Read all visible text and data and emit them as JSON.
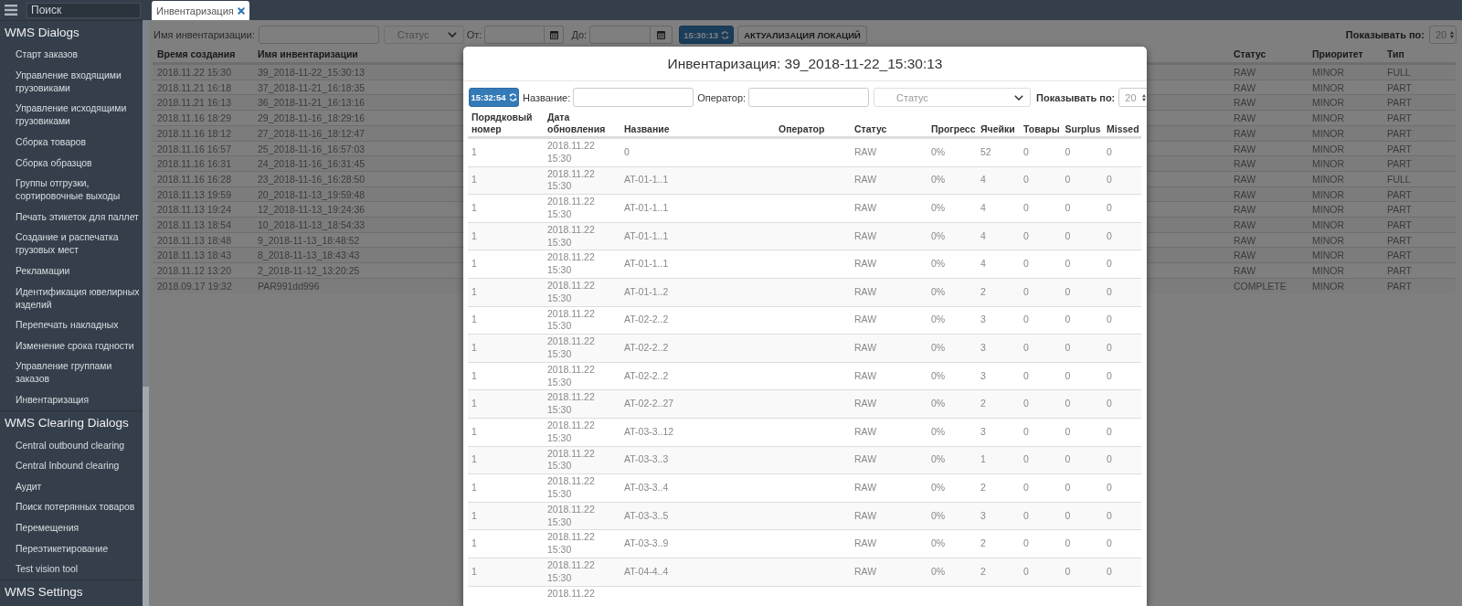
{
  "sidebar": {
    "search": {
      "placeholder": "Поиск"
    },
    "sections": [
      {
        "title": "WMS Dialogs",
        "items": [
          "Старт заказов",
          "Управление входящими грузовиками",
          "Управление исходящими грузовиками",
          "Сборка товаров",
          "Сборка образцов",
          "Группы отгрузки, сортировочные выходы",
          "Печать этикеток для паллет",
          "Создание и распечатка грузовых мест",
          "Рекламации",
          "Идентификация ювелирных изделий",
          "Перепечать накладных",
          "Изменение срока годности",
          "Управление группами заказов",
          "Инвентаризация"
        ]
      },
      {
        "title": "WMS Clearing Dialogs",
        "items": [
          "Central outbound clearing",
          "Central Inbound clearing",
          "Аудит",
          "Поиск потерянных товаров",
          "Перемещения",
          "Переэтикетирование",
          "Test vision tool"
        ]
      },
      {
        "title": "WMS Settings"
      }
    ]
  },
  "tabs": [
    {
      "label": "Инвентаризация",
      "selected": true
    }
  ],
  "toolbar": {
    "name_label": "Имя инвентаризации:",
    "status_placeholder": "Статус",
    "from_label": "От:",
    "to_label": "До:",
    "refresh_time": "15:30:13",
    "locations_button": "АКТУАЛИЗАЦИЯ ЛОКАЦИЙ",
    "page_size_label": "Показывать по:",
    "page_size": "20"
  },
  "table": {
    "columns": [
      "Время создания",
      "Имя инвентаризации",
      "Статус",
      "Приоритет",
      "Тип"
    ],
    "rows": [
      [
        "2018.11.22 15:30",
        "39_2018-11-22_15:30:13",
        "RAW",
        "MINOR",
        "FULL"
      ],
      [
        "2018.11.21 16:18",
        "37_2018-11-21_16:18:35",
        "RAW",
        "MINOR",
        "PART"
      ],
      [
        "2018.11.21 16:13",
        "36_2018-11-21_16:13:16",
        "RAW",
        "MINOR",
        "PART"
      ],
      [
        "2018.11.16 18:29",
        "29_2018-11-16_18:29:16",
        "RAW",
        "MINOR",
        "PART"
      ],
      [
        "2018.11.16 18:12",
        "27_2018-11-16_18:12:47",
        "RAW",
        "MINOR",
        "PART"
      ],
      [
        "2018.11.16 16:57",
        "25_2018-11-16_16:57:03",
        "RAW",
        "MINOR",
        "PART"
      ],
      [
        "2018.11.16 16:31",
        "24_2018-11-16_16:31:45",
        "RAW",
        "MINOR",
        "PART"
      ],
      [
        "2018.11.16 16:28",
        "23_2018-11-16_16:28:50",
        "RAW",
        "MINOR",
        "FULL"
      ],
      [
        "2018.11.13 19:59",
        "20_2018-11-13_19:59:48",
        "RAW",
        "MINOR",
        "PART"
      ],
      [
        "2018.11.13 19:24",
        "12_2018-11-13_19:24:36",
        "RAW",
        "MINOR",
        "PART"
      ],
      [
        "2018.11.13 18:54",
        "10_2018-11-13_18:54:33",
        "RAW",
        "MINOR",
        "PART"
      ],
      [
        "2018.11.13 18:48",
        "9_2018-11-13_18:48:52",
        "RAW",
        "MINOR",
        "PART"
      ],
      [
        "2018.11.13 18:43",
        "8_2018-11-13_18:43:43",
        "RAW",
        "MINOR",
        "PART"
      ],
      [
        "2018.11.12 13:20",
        "2_2018-11-12_13:20:25",
        "RAW",
        "MINOR",
        "PART"
      ],
      [
        "2018.09.17 19:32",
        "PAR991dd996",
        "COMPLETE",
        "MINOR",
        "PART"
      ]
    ]
  },
  "dialog": {
    "title": "Инвентаризация: 39_2018-11-22_15:30:13",
    "refresh_time": "15:32:54",
    "name_label": "Название:",
    "operator_label": "Оператор:",
    "status_placeholder": "Статус",
    "page_size_label": "Показывать по:",
    "page_size": "20",
    "columns": [
      "Порядковый номер",
      "Дата обновления",
      "Название",
      "Оператор",
      "Статус",
      "Прогресс",
      "Ячейки",
      "Товары",
      "Surplus",
      "Missed"
    ],
    "rows": [
      {
        "number": "1",
        "updated": "2018.11.22 15:30",
        "name": "0",
        "status": "RAW",
        "progress": "0%",
        "cells": "52",
        "goods": "0",
        "surplus": "0",
        "missed": "0"
      },
      {
        "number": "1",
        "updated": "2018.11.22 15:30",
        "name": "AT-01-1..1",
        "status": "RAW",
        "progress": "0%",
        "cells": "4",
        "goods": "0",
        "surplus": "0",
        "missed": "0"
      },
      {
        "number": "1",
        "updated": "2018.11.22 15:30",
        "name": "AT-01-1..1",
        "status": "RAW",
        "progress": "0%",
        "cells": "4",
        "goods": "0",
        "surplus": "0",
        "missed": "0"
      },
      {
        "number": "1",
        "updated": "2018.11.22 15:30",
        "name": "AT-01-1..1",
        "status": "RAW",
        "progress": "0%",
        "cells": "4",
        "goods": "0",
        "surplus": "0",
        "missed": "0"
      },
      {
        "number": "1",
        "updated": "2018.11.22 15:30",
        "name": "AT-01-1..1",
        "status": "RAW",
        "progress": "0%",
        "cells": "4",
        "goods": "0",
        "surplus": "0",
        "missed": "0"
      },
      {
        "number": "1",
        "updated": "2018.11.22 15:30",
        "name": "AT-01-1..2",
        "status": "RAW",
        "progress": "0%",
        "cells": "2",
        "goods": "0",
        "surplus": "0",
        "missed": "0"
      },
      {
        "number": "1",
        "updated": "2018.11.22 15:30",
        "name": "AT-02-2..2",
        "status": "RAW",
        "progress": "0%",
        "cells": "3",
        "goods": "0",
        "surplus": "0",
        "missed": "0"
      },
      {
        "number": "1",
        "updated": "2018.11.22 15:30",
        "name": "AT-02-2..2",
        "status": "RAW",
        "progress": "0%",
        "cells": "3",
        "goods": "0",
        "surplus": "0",
        "missed": "0"
      },
      {
        "number": "1",
        "updated": "2018.11.22 15:30",
        "name": "AT-02-2..2",
        "status": "RAW",
        "progress": "0%",
        "cells": "3",
        "goods": "0",
        "surplus": "0",
        "missed": "0"
      },
      {
        "number": "1",
        "updated": "2018.11.22 15:30",
        "name": "AT-02-2..27",
        "status": "RAW",
        "progress": "0%",
        "cells": "2",
        "goods": "0",
        "surplus": "0",
        "missed": "0"
      },
      {
        "number": "1",
        "updated": "2018.11.22 15:30",
        "name": "AT-03-3..12",
        "status": "RAW",
        "progress": "0%",
        "cells": "3",
        "goods": "0",
        "surplus": "0",
        "missed": "0"
      },
      {
        "number": "1",
        "updated": "2018.11.22 15:30",
        "name": "AT-03-3..3",
        "status": "RAW",
        "progress": "0%",
        "cells": "1",
        "goods": "0",
        "surplus": "0",
        "missed": "0"
      },
      {
        "number": "1",
        "updated": "2018.11.22 15:30",
        "name": "AT-03-3..4",
        "status": "RAW",
        "progress": "0%",
        "cells": "2",
        "goods": "0",
        "surplus": "0",
        "missed": "0"
      },
      {
        "number": "1",
        "updated": "2018.11.22 15:30",
        "name": "AT-03-3..5",
        "status": "RAW",
        "progress": "0%",
        "cells": "3",
        "goods": "0",
        "surplus": "0",
        "missed": "0"
      },
      {
        "number": "1",
        "updated": "2018.11.22 15:30",
        "name": "AT-03-3..9",
        "status": "RAW",
        "progress": "0%",
        "cells": "2",
        "goods": "0",
        "surplus": "0",
        "missed": "0"
      },
      {
        "number": "1",
        "updated": "2018.11.22 15:30",
        "name": "AT-04-4..4",
        "status": "RAW",
        "progress": "0%",
        "cells": "2",
        "goods": "0",
        "surplus": "0",
        "missed": "0"
      },
      {
        "updated": "2018.11.22"
      }
    ]
  }
}
